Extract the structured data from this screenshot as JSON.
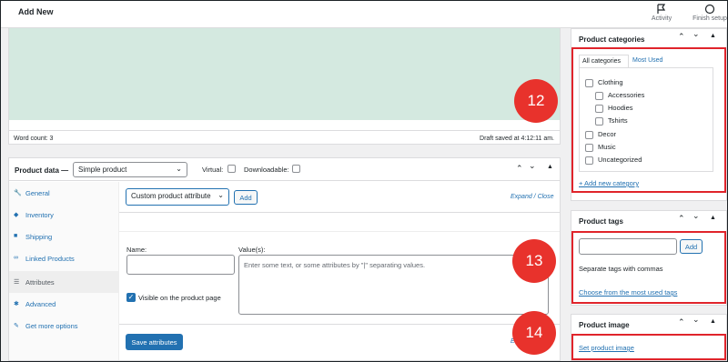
{
  "topbar": {
    "title": "Add New",
    "activity": "Activity",
    "finish_setup": "Finish setup"
  },
  "editor": {
    "word_count": "Word count: 3",
    "draft_saved": "Draft saved at 4:12:11 am."
  },
  "product_data": {
    "label": "Product data —",
    "type_selected": "Simple product",
    "virtual": "Virtual:",
    "downloadable": "Downloadable:",
    "tabs": [
      {
        "label": "General",
        "icon": "wrench-icon"
      },
      {
        "label": "Inventory",
        "icon": "tag-icon"
      },
      {
        "label": "Shipping",
        "icon": "truck-icon"
      },
      {
        "label": "Linked Products",
        "icon": "link-icon"
      },
      {
        "label": "Attributes",
        "icon": "list-icon"
      },
      {
        "label": "Advanced",
        "icon": "gear-icon"
      },
      {
        "label": "Get more options",
        "icon": "plugin-icon"
      }
    ],
    "attribute_select": "Custom product attribute",
    "add_button": "Add",
    "expand_close": "Expand / Close",
    "name_label": "Name:",
    "values_label": "Value(s):",
    "values_placeholder": "Enter some text, or some attributes by \"|\" separating values.",
    "visible_label": "Visible on the product page",
    "save_attributes": "Save attributes",
    "partial_expand": "Ex"
  },
  "categories": {
    "title": "Product categories",
    "tab_all": "All categories",
    "tab_most_used": "Most Used",
    "items": [
      "Clothing",
      "Accessories",
      "Hoodies",
      "Tshirts",
      "Decor",
      "Music",
      "Uncategorized"
    ],
    "add_new": "+ Add new category"
  },
  "tags": {
    "title": "Product tags",
    "add_button": "Add",
    "hint": "Separate tags with commas",
    "most_used_link": "Choose from the most used tags"
  },
  "image": {
    "title": "Product image",
    "set_link": "Set product image"
  },
  "badges": [
    "12",
    "13",
    "14"
  ],
  "colors": {
    "accent": "#2271b1",
    "highlight": "#e0242b",
    "badge": "#e8322c",
    "editor_bg": "#d4e9e0"
  }
}
